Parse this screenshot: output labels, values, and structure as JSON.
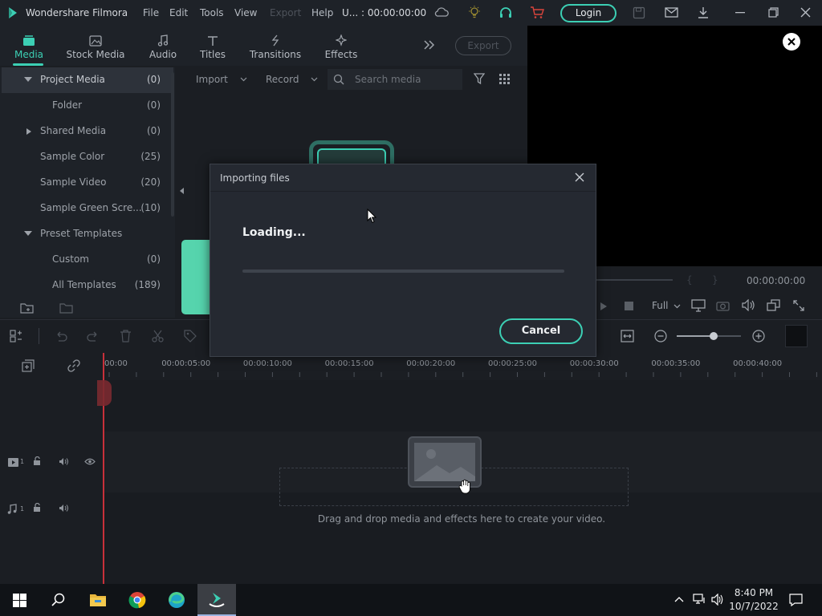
{
  "app": {
    "title": "Wondershare Filmora"
  },
  "menu": {
    "file": "File",
    "edit": "Edit",
    "tools": "Tools",
    "view": "View",
    "export": "Export",
    "help": "Help",
    "project": "U... : 00:00:00:00",
    "login": "Login"
  },
  "tabs": [
    {
      "label": "Media",
      "icon": "media-icon",
      "active": true
    },
    {
      "label": "Stock Media",
      "icon": "stock-media-icon"
    },
    {
      "label": "Audio",
      "icon": "music-note-icon"
    },
    {
      "label": "Titles",
      "icon": "text-icon"
    },
    {
      "label": "Transitions",
      "icon": "transition-icon"
    },
    {
      "label": "Effects",
      "icon": "effects-icon"
    }
  ],
  "export_button": "Export",
  "sidebar": {
    "items": [
      {
        "label": "Project Media",
        "count": "(0)"
      },
      {
        "label": "Folder",
        "count": "(0)"
      },
      {
        "label": "Shared Media",
        "count": "(0)"
      },
      {
        "label": "Sample Color",
        "count": "(25)"
      },
      {
        "label": "Sample Video",
        "count": "(20)"
      },
      {
        "label": "Sample Green Scre...",
        "count": "(10)"
      },
      {
        "label": "Preset Templates",
        "count": ""
      },
      {
        "label": "Custom",
        "count": "(0)"
      },
      {
        "label": "All Templates",
        "count": "(189)"
      }
    ]
  },
  "media_toolbar": {
    "import": "Import",
    "record": "Record",
    "search_placeholder": "Search media"
  },
  "preview": {
    "timecode": "00:00:00:00",
    "zoom": "Full",
    "bracket_in": "{",
    "bracket_out": "}"
  },
  "timeline": {
    "ticks": [
      "00:00",
      "00:00:05:00",
      "00:00:10:00",
      "00:00:15:00",
      "00:00:20:00",
      "00:00:25:00",
      "00:00:30:00",
      "00:00:35:00",
      "00:00:40:00"
    ],
    "video_track": "1",
    "audio_track": "1",
    "drop_hint": "Drag and drop media and effects here to create your video.",
    "zoom_level": 0.58
  },
  "dialog": {
    "title": "Importing files",
    "status": "Loading...",
    "progress": 0.0,
    "cancel": "Cancel"
  },
  "taskbar": {
    "time": "8:40 PM",
    "date": "10/7/2022"
  },
  "colors": {
    "accent": "#3ccfb4",
    "background": "#1b1e23",
    "playhead": "#c8303a"
  }
}
